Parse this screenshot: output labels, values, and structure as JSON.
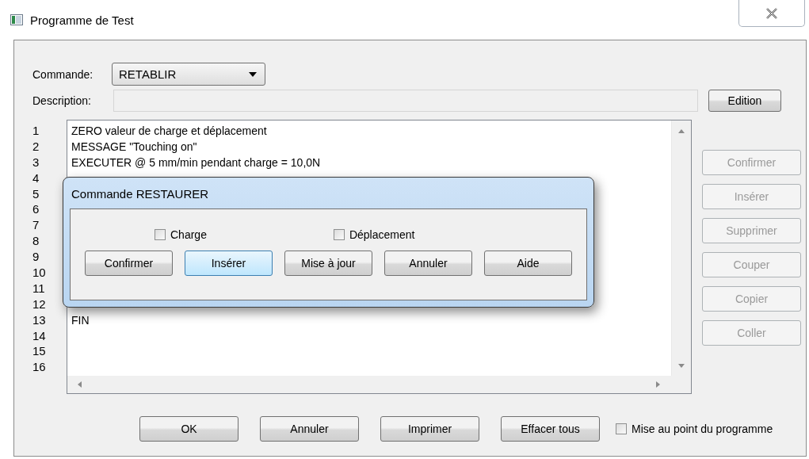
{
  "window": {
    "title": "Programme de Test"
  },
  "command": {
    "label": "Commande:",
    "value": "RETABLIR"
  },
  "description": {
    "label": "Description:",
    "button": "Edition"
  },
  "editor": {
    "line_numbers": [
      "1",
      "2",
      "3",
      "4",
      "5",
      "6",
      "7",
      "8",
      "9",
      "10",
      "11",
      "12",
      "13",
      "14",
      "15",
      "16"
    ],
    "text_top": [
      "ZERO valeur de charge et déplacement",
      "MESSAGE \"Touching on\"",
      "EXECUTER @ 5 mm/min pendant charge = 10,0N"
    ],
    "text_bottom": [
      "FIN"
    ]
  },
  "side_buttons": [
    {
      "label": "Confirmer",
      "disabled": true
    },
    {
      "label": "Insérer",
      "disabled": true
    },
    {
      "label": "Supprimer",
      "disabled": true
    },
    {
      "label": "Couper",
      "disabled": true
    },
    {
      "label": "Copier",
      "disabled": true
    },
    {
      "label": "Coller",
      "disabled": true
    }
  ],
  "bottom_buttons": [
    {
      "label": "OK"
    },
    {
      "label": "Annuler"
    },
    {
      "label": "Imprimer"
    },
    {
      "label": "Effacer tous"
    }
  ],
  "debug_checkbox": {
    "label": "Mise au point du programme",
    "checked": false
  },
  "dialog": {
    "title": "Commande RESTAURER",
    "checkboxes": [
      {
        "label": "Charge",
        "checked": false
      },
      {
        "label": "Déplacement",
        "checked": false
      }
    ],
    "buttons": [
      {
        "label": "Confirmer",
        "highlighted": false
      },
      {
        "label": "Insérer",
        "highlighted": true
      },
      {
        "label": "Mise à jour",
        "highlighted": false
      },
      {
        "label": "Annuler",
        "highlighted": false
      },
      {
        "label": "Aide",
        "highlighted": false
      }
    ]
  }
}
